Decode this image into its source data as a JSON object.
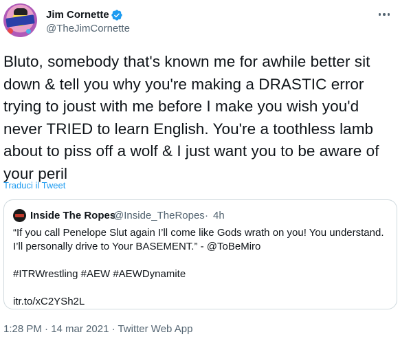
{
  "author": {
    "name": "Jim Cornette",
    "handle": "@TheJimCornette",
    "verified": true
  },
  "tweet": {
    "text": "Bluto, somebody that's known me for awhile better sit\ndown & tell you why you're making a DRASTIC error\ntrying to joust with me before I make you wish you'd\nnever TRIED to learn English. You're a toothless lamb\nabout to piss off a wolf & I just want you to be aware of\nyour peril",
    "translate_label": "Traduci il Tweet",
    "meta": "1:28 PM · 14 mar 2021 · Twitter Web App"
  },
  "quoted": {
    "name": "Inside The Ropes",
    "handle": "@Inside_TheRopes",
    "separator": "·",
    "time": "4h",
    "text": "“If you call Penelope Slut again I’ll come like Gods wrath on you! You understand.\nI’ll personally drive to Your BASEMENT.” - @ToBeMiro\n\n#ITRWrestling #AEW #AEWDynamite\n\nitr.to/xC2YSh2L"
  },
  "colors": {
    "accent": "#1d9bf0",
    "text": "#0f1419",
    "secondary": "#536471",
    "border": "#cfd9de"
  },
  "icons": {
    "verified": "verified-badge-icon",
    "more": "more-options-icon"
  }
}
